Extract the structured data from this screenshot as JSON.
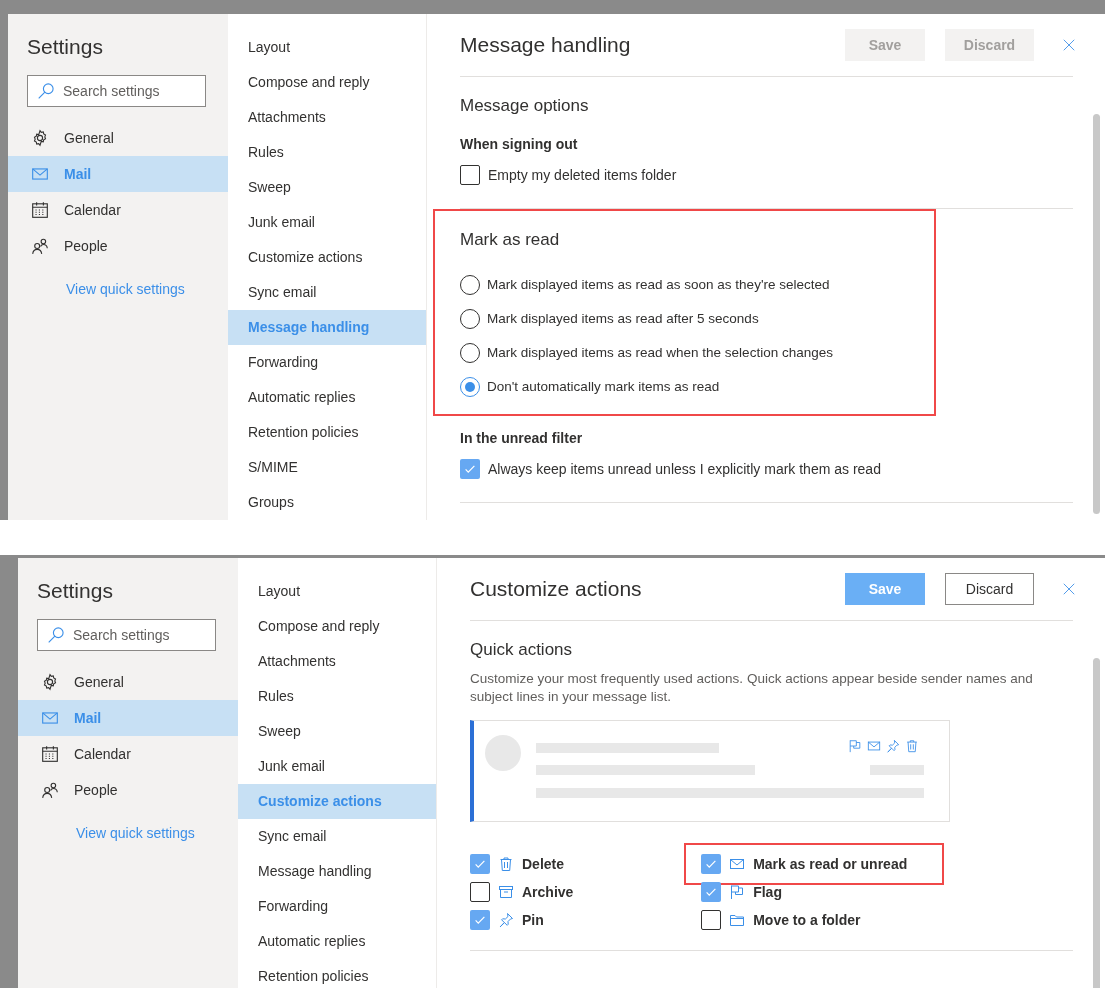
{
  "panels": [
    {
      "nav": {
        "title": "Settings",
        "search": {
          "placeholder": "Search settings"
        },
        "categories": [
          {
            "label": "General",
            "selected": false
          },
          {
            "label": "Mail",
            "selected": true
          },
          {
            "label": "Calendar",
            "selected": false
          },
          {
            "label": "People",
            "selected": false
          }
        ],
        "quick_settings_link": "View quick settings"
      },
      "subnav": [
        {
          "label": "Layout",
          "selected": false
        },
        {
          "label": "Compose and reply",
          "selected": false
        },
        {
          "label": "Attachments",
          "selected": false
        },
        {
          "label": "Rules",
          "selected": false
        },
        {
          "label": "Sweep",
          "selected": false
        },
        {
          "label": "Junk email",
          "selected": false
        },
        {
          "label": "Customize actions",
          "selected": false
        },
        {
          "label": "Sync email",
          "selected": false
        },
        {
          "label": "Message handling",
          "selected": true
        },
        {
          "label": "Forwarding",
          "selected": false
        },
        {
          "label": "Automatic replies",
          "selected": false
        },
        {
          "label": "Retention policies",
          "selected": false
        },
        {
          "label": "S/MIME",
          "selected": false
        },
        {
          "label": "Groups",
          "selected": false
        }
      ],
      "header": {
        "title": "Message handling",
        "buttons": [
          {
            "label": "Save",
            "kind": "primary",
            "disabled": true
          },
          {
            "label": "Discard",
            "kind": "secondary",
            "disabled": true
          }
        ]
      },
      "sections": [
        {
          "title": "Message options",
          "highlighted": false,
          "divider_after": true,
          "blocks": [
            {
              "kind": "subheading",
              "text": "When signing out"
            },
            {
              "kind": "checkbox",
              "label": "Empty my deleted items folder",
              "checked": false
            }
          ]
        },
        {
          "title": "Mark as read",
          "highlighted": true,
          "divider_after": false,
          "blocks": [
            {
              "kind": "radio",
              "label": "Mark displayed items as read as soon as they're selected",
              "selected": false
            },
            {
              "kind": "radio",
              "label": "Mark displayed items as read after 5 seconds",
              "selected": false
            },
            {
              "kind": "radio",
              "label": "Mark displayed items as read when the selection changes",
              "selected": false
            },
            {
              "kind": "radio",
              "label": "Don't automatically mark items as read",
              "selected": true
            }
          ]
        },
        {
          "highlighted": false,
          "divider_after": true,
          "blocks": [
            {
              "kind": "subheading",
              "text": "In the unread filter"
            },
            {
              "kind": "checkbox",
              "label": "Always keep items unread unless I explicitly mark them as read",
              "checked": true
            }
          ]
        }
      ]
    },
    {
      "nav": {
        "title": "Settings",
        "search": {
          "placeholder": "Search settings"
        },
        "categories": [
          {
            "label": "General",
            "selected": false
          },
          {
            "label": "Mail",
            "selected": true
          },
          {
            "label": "Calendar",
            "selected": false
          },
          {
            "label": "People",
            "selected": false
          }
        ],
        "quick_settings_link": "View quick settings"
      },
      "subnav": [
        {
          "label": "Layout",
          "selected": false
        },
        {
          "label": "Compose and reply",
          "selected": false
        },
        {
          "label": "Attachments",
          "selected": false
        },
        {
          "label": "Rules",
          "selected": false
        },
        {
          "label": "Sweep",
          "selected": false
        },
        {
          "label": "Junk email",
          "selected": false
        },
        {
          "label": "Customize actions",
          "selected": true
        },
        {
          "label": "Sync email",
          "selected": false
        },
        {
          "label": "Message handling",
          "selected": false
        },
        {
          "label": "Forwarding",
          "selected": false
        },
        {
          "label": "Automatic replies",
          "selected": false
        },
        {
          "label": "Retention policies",
          "selected": false
        }
      ],
      "header": {
        "title": "Customize actions",
        "buttons": [
          {
            "label": "Save",
            "kind": "primary",
            "disabled": false
          },
          {
            "label": "Discard",
            "kind": "secondary",
            "disabled": false
          }
        ]
      },
      "sections": [
        {
          "title": "Quick actions",
          "highlighted": false,
          "divider_after": true,
          "blocks": [
            {
              "kind": "paragraph",
              "text": "Customize your most frequently used actions. Quick actions appear beside sender names and subject lines in your message list."
            },
            {
              "kind": "preview"
            },
            {
              "kind": "actions",
              "items": [
                {
                  "label": "Delete",
                  "checked": true,
                  "highlighted": false
                },
                {
                  "label": "Archive",
                  "checked": false,
                  "highlighted": false
                },
                {
                  "label": "Pin",
                  "checked": true,
                  "highlighted": false
                },
                {
                  "label": "Mark as read or unread",
                  "checked": true,
                  "highlighted": true
                },
                {
                  "label": "Flag",
                  "checked": true,
                  "highlighted": false
                },
                {
                  "label": "Move to a folder",
                  "checked": false,
                  "highlighted": false
                }
              ]
            }
          ]
        }
      ]
    }
  ]
}
